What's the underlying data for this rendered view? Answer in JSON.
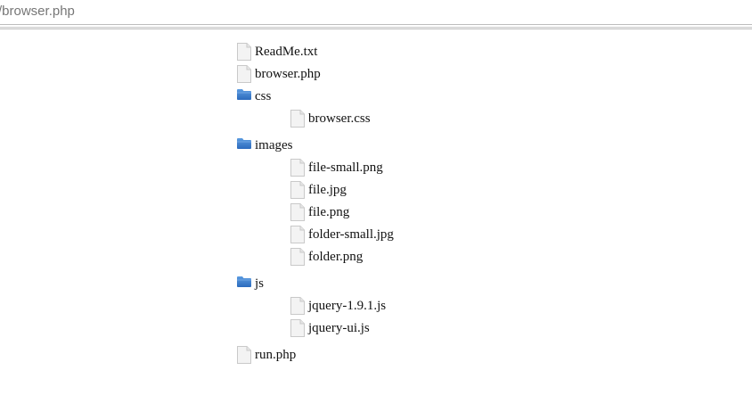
{
  "address_bar": {
    "url_text": "/browser.php"
  },
  "tree": {
    "items": [
      {
        "type": "file",
        "name": "ReadMe.txt"
      },
      {
        "type": "file",
        "name": "browser.php"
      },
      {
        "type": "folder",
        "name": "css",
        "children": [
          {
            "type": "file",
            "name": "browser.css"
          }
        ]
      },
      {
        "type": "folder",
        "name": "images",
        "children": [
          {
            "type": "file",
            "name": "file-small.png"
          },
          {
            "type": "file",
            "name": "file.jpg"
          },
          {
            "type": "file",
            "name": "file.png"
          },
          {
            "type": "file",
            "name": "folder-small.jpg"
          },
          {
            "type": "file",
            "name": "folder.png"
          }
        ]
      },
      {
        "type": "folder",
        "name": "js",
        "children": [
          {
            "type": "file",
            "name": "jquery-1.9.1.js"
          },
          {
            "type": "file",
            "name": "jquery-ui.js"
          }
        ]
      },
      {
        "type": "file",
        "name": "run.php"
      }
    ]
  },
  "icons": {
    "file": "file-icon",
    "folder": "folder-icon"
  },
  "colors": {
    "file_icon_fill": "#f3f3f3",
    "file_icon_stroke": "#c9c9c9",
    "folder_top": "#5b9be0",
    "folder_bottom": "#2c6bbd"
  }
}
